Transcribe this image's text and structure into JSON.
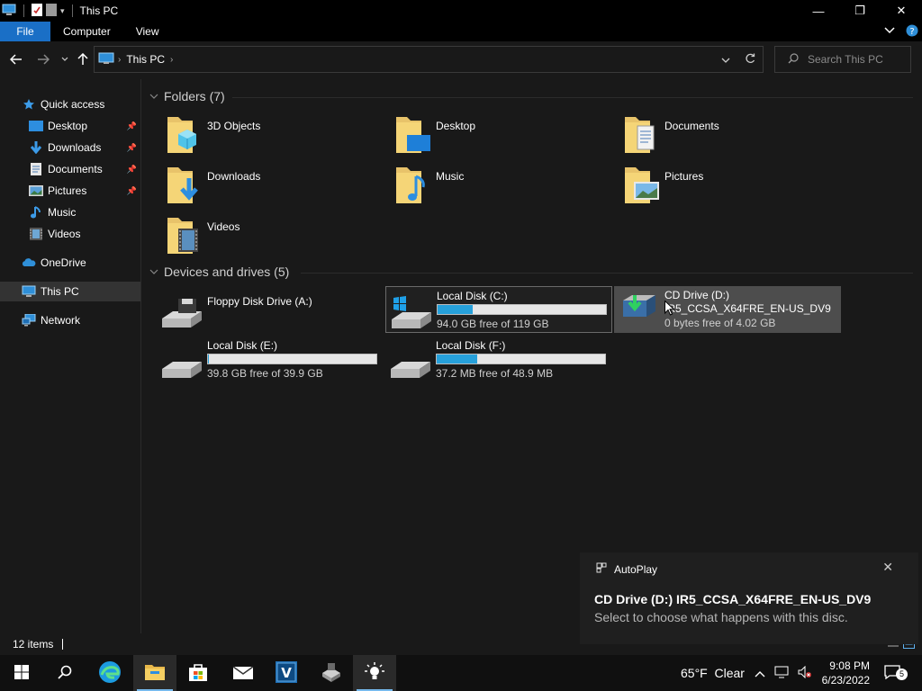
{
  "window": {
    "title": "This PC",
    "controls": {
      "minimize": "—",
      "maximize": "❐",
      "close": "✕"
    }
  },
  "ribbon": {
    "tabs": [
      "File",
      "Computer",
      "View"
    ],
    "expand_icon": "chevron-down-icon",
    "help_icon": "help-icon"
  },
  "address": {
    "path": "This PC",
    "search_placeholder": "Search This PC"
  },
  "nav": {
    "quick_access": "Quick access",
    "pinned": [
      {
        "label": "Desktop",
        "pinned": true
      },
      {
        "label": "Downloads",
        "pinned": true
      },
      {
        "label": "Documents",
        "pinned": true
      },
      {
        "label": "Pictures",
        "pinned": true
      },
      {
        "label": "Music",
        "pinned": false
      },
      {
        "label": "Videos",
        "pinned": false
      }
    ],
    "onedrive": "OneDrive",
    "this_pc": "This PC",
    "network": "Network"
  },
  "folders": {
    "header": "Folders (7)",
    "items": [
      "3D Objects",
      "Desktop",
      "Documents",
      "Downloads",
      "Music",
      "Pictures",
      "Videos"
    ]
  },
  "devices": {
    "header": "Devices and drives (5)",
    "items": [
      {
        "name": "Floppy Disk Drive (A:)",
        "has_bar": false
      },
      {
        "name": "Local Disk (C:)",
        "free": "94.0 GB free of 119 GB",
        "used_fraction": 0.21,
        "has_bar": true
      },
      {
        "name": "CD Drive (D:)",
        "label": "IR5_CCSA_X64FRE_EN-US_DV9",
        "free": "0 bytes free of 4.02 GB",
        "has_bar": false
      },
      {
        "name": "Local Disk (E:)",
        "free": "39.8 GB free of 39.9 GB",
        "used_fraction": 0.003,
        "has_bar": true
      },
      {
        "name": "Local Disk (F:)",
        "free": "37.2 MB free of 48.9 MB",
        "used_fraction": 0.24,
        "has_bar": true
      }
    ]
  },
  "status": {
    "count": "12 items"
  },
  "toast": {
    "app": "AutoPlay",
    "title": "CD Drive (D:) IR5_CCSA_X64FRE_EN-US_DV9",
    "message": "Select to choose what happens with this disc."
  },
  "taskbar": {
    "weather": "65°F  Clear",
    "time": "9:08 PM",
    "date": "6/23/2022",
    "notifications": "5"
  }
}
